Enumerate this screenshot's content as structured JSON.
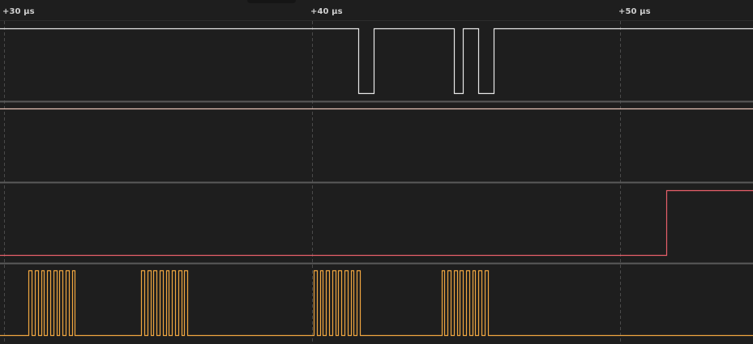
{
  "timeline": {
    "ticks": [
      {
        "label": "+30 µs",
        "time_us": 30
      },
      {
        "label": "+40 µs",
        "time_us": 40
      },
      {
        "label": "+50 µs",
        "time_us": 50
      }
    ]
  },
  "colors": {
    "background": "#1e1e1e",
    "separator": "#5a5a5a",
    "grid": "#4a4a4a",
    "channel_0": "#e8e8e8",
    "channel_1": "#e8c4b8",
    "channel_2": "#e8606a",
    "channel_3": "#f0a640"
  },
  "channels": [
    {
      "id": "channel-0",
      "color_key": "channel_0",
      "initial_level": 1,
      "edges_us": [
        41.5,
        42.0,
        44.6,
        44.9,
        45.4,
        45.9
      ]
    },
    {
      "id": "channel-1",
      "color_key": "channel_1",
      "initial_level": 1,
      "edges_us": []
    },
    {
      "id": "channel-2",
      "color_key": "channel_2",
      "initial_level": 0,
      "edges_us": [
        51.5
      ]
    },
    {
      "id": "channel-3",
      "color_key": "channel_3",
      "initial_level": 0,
      "pulse_bursts": [
        {
          "start_us": 30.8,
          "count": 8,
          "high_us": 0.1,
          "low_us": 0.1
        },
        {
          "start_us": 34.45,
          "count": 8,
          "high_us": 0.1,
          "low_us": 0.1
        },
        {
          "start_us": 40.05,
          "count": 8,
          "high_us": 0.1,
          "low_us": 0.1
        },
        {
          "start_us": 44.2,
          "count": 8,
          "high_us": 0.1,
          "low_us": 0.1
        }
      ]
    }
  ]
}
